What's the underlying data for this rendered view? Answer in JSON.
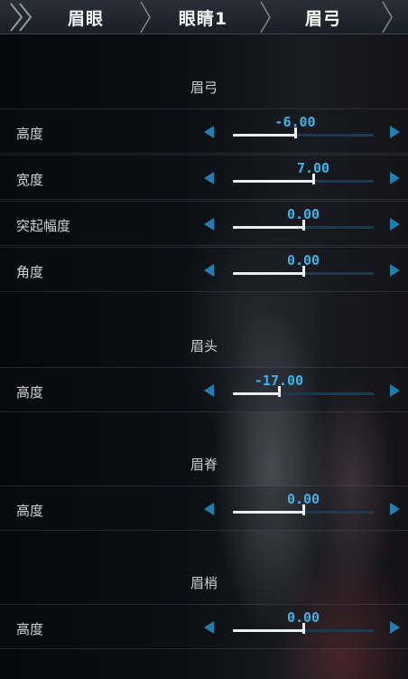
{
  "tabs": [
    {
      "label": "眉眼"
    },
    {
      "label": "眼睛1"
    },
    {
      "label": "眉弓"
    }
  ],
  "sections": [
    {
      "title": "眉弓",
      "rows": [
        {
          "label": "高度",
          "value": "-6.00",
          "level": 0.44
        },
        {
          "label": "宽度",
          "value": "7.00",
          "level": 0.57
        },
        {
          "label": "突起幅度",
          "value": "0.00",
          "level": 0.5
        },
        {
          "label": "角度",
          "value": "0.00",
          "level": 0.5
        }
      ]
    },
    {
      "title": "眉头",
      "rows": [
        {
          "label": "高度",
          "value": "-17.00",
          "level": 0.33
        }
      ]
    },
    {
      "title": "眉脊",
      "rows": [
        {
          "label": "高度",
          "value": "0.00",
          "level": 0.5
        }
      ]
    },
    {
      "title": "眉梢",
      "rows": [
        {
          "label": "高度",
          "value": "0.00",
          "level": 0.5
        }
      ]
    }
  ],
  "colors": {
    "accent": "#3fb2e8",
    "arrow": "#1f7fb0",
    "track": "#1b3a4f"
  },
  "icons": {
    "left_arrow": "triangle-left-icon",
    "right_arrow": "triangle-right-icon",
    "back": "double-chevron-left-icon"
  }
}
